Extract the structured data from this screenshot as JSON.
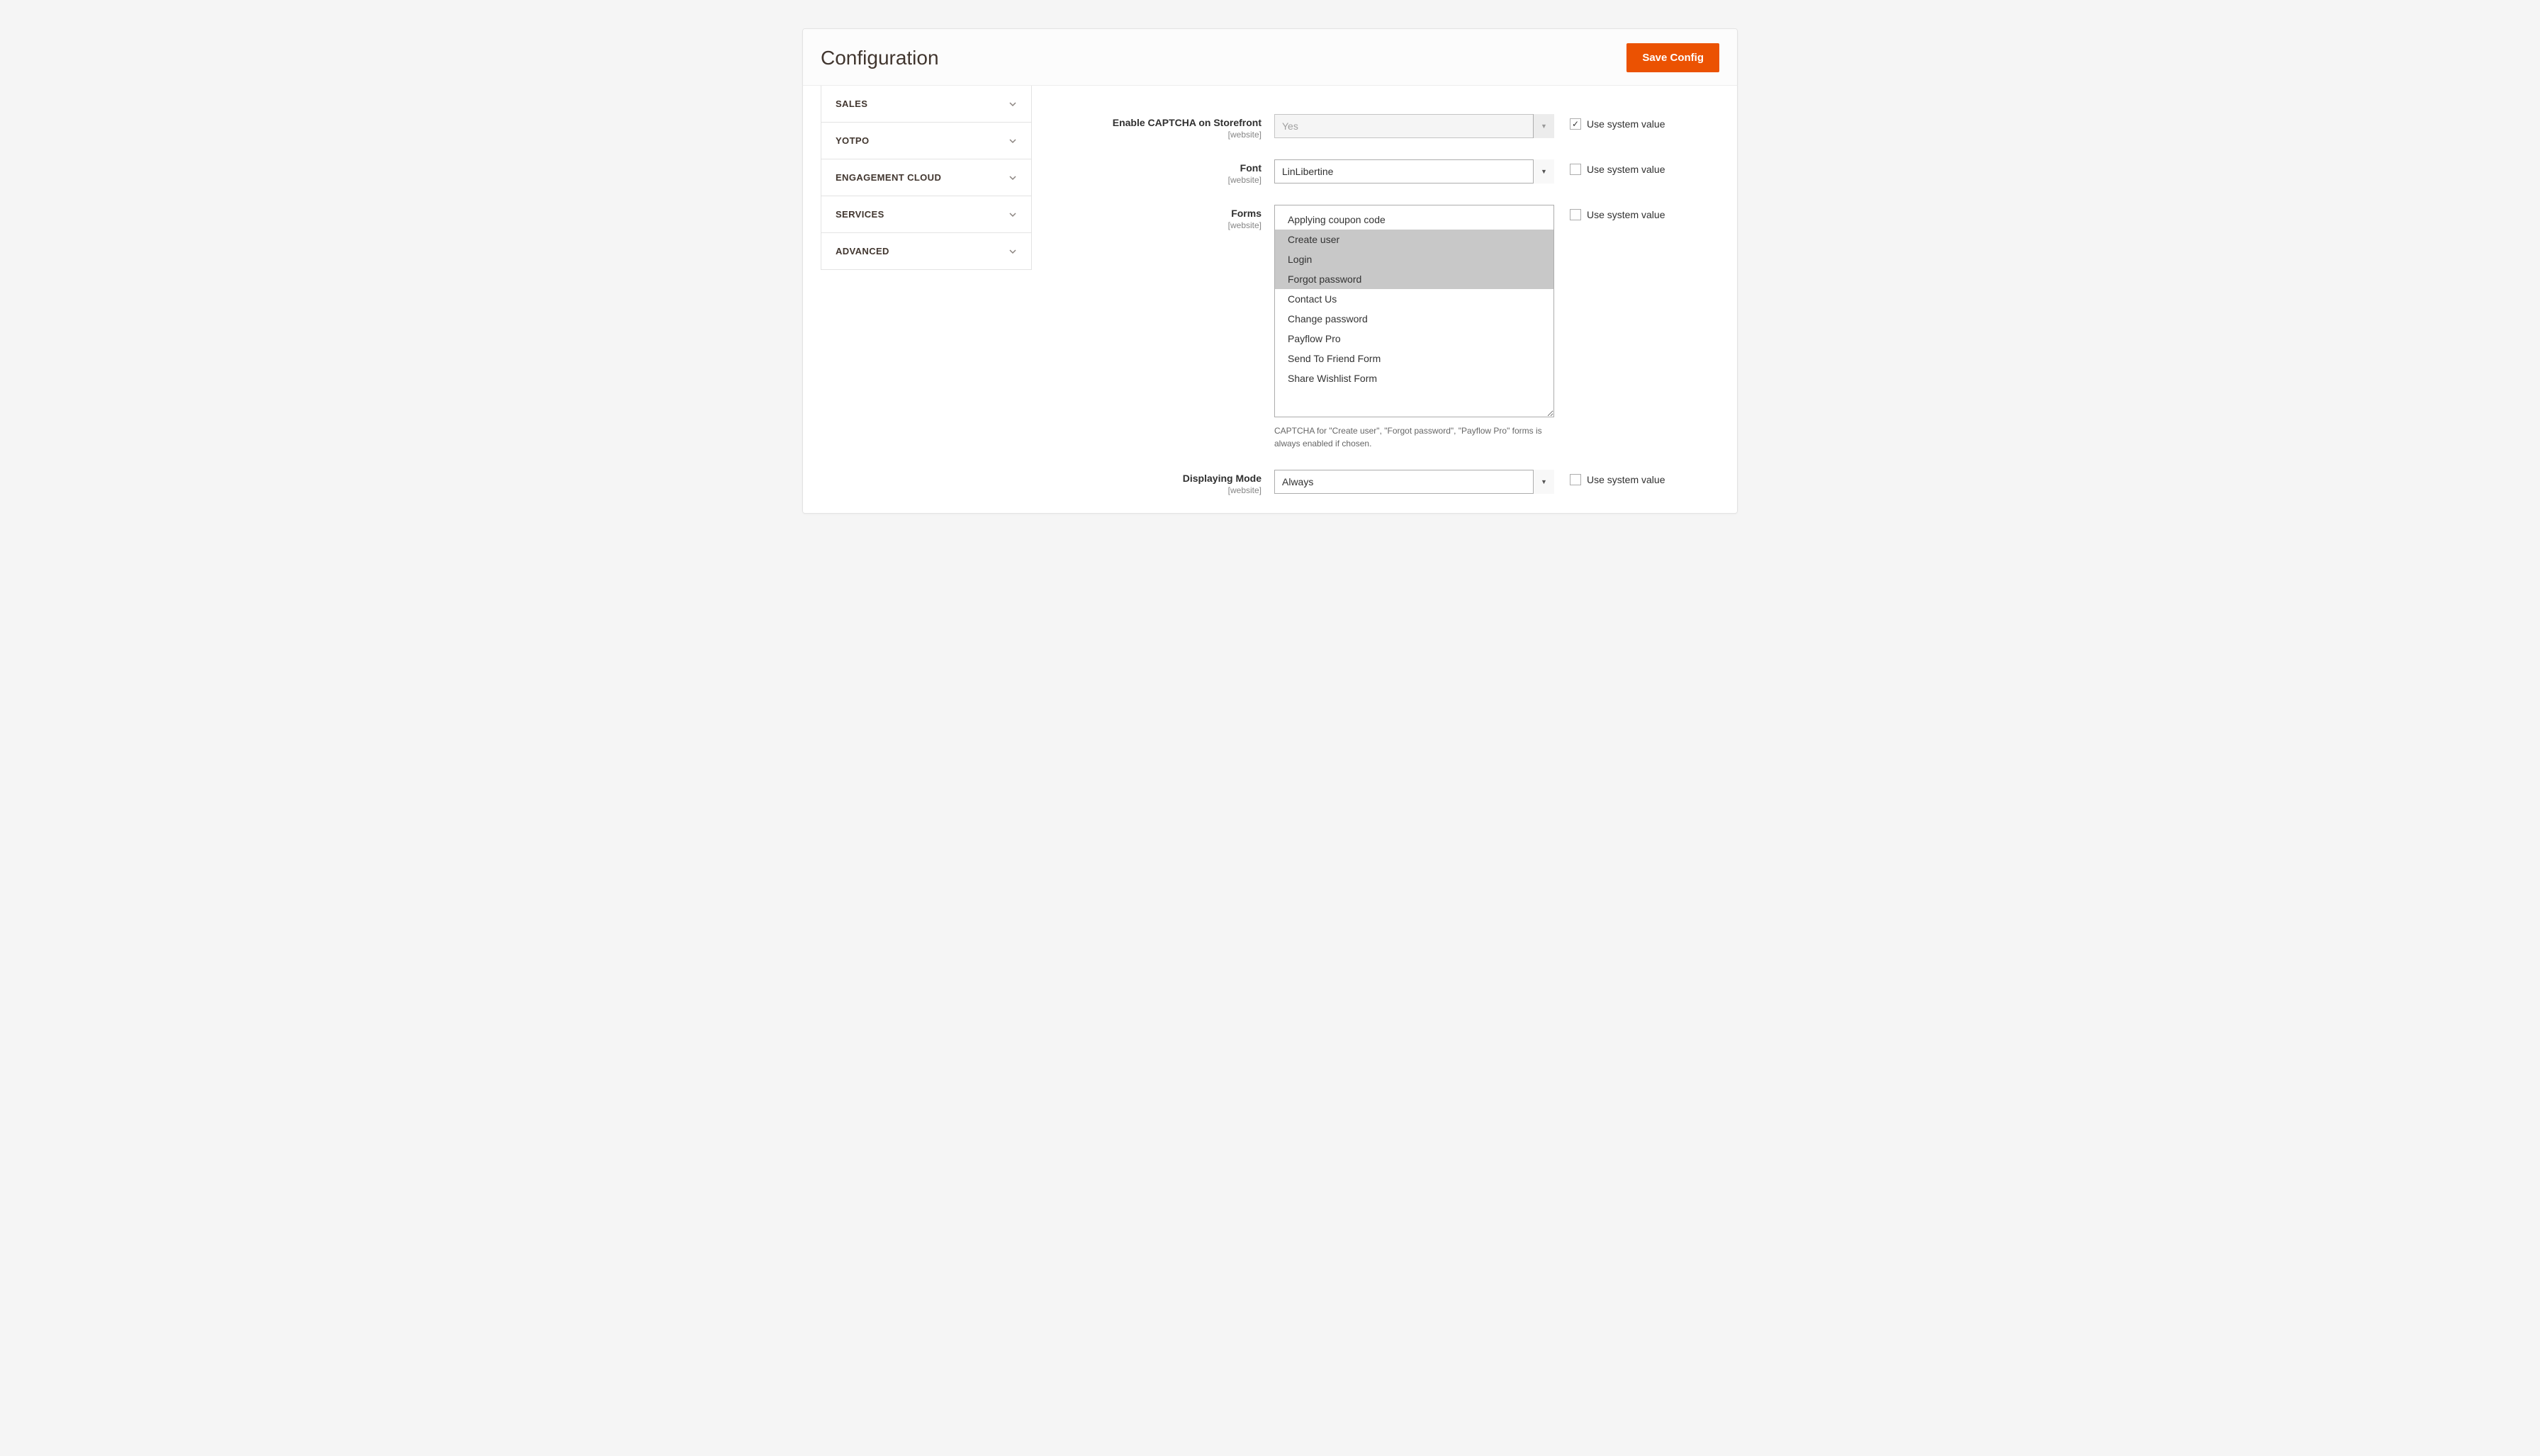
{
  "page": {
    "title": "Configuration",
    "save_button": "Save Config"
  },
  "sidebar": {
    "items": [
      {
        "label": "SALES"
      },
      {
        "label": "YOTPO"
      },
      {
        "label": "ENGAGEMENT CLOUD"
      },
      {
        "label": "SERVICES"
      },
      {
        "label": "ADVANCED"
      }
    ]
  },
  "scope_label": "[website]",
  "system_value_label": "Use system value",
  "fields": {
    "enable_captcha": {
      "label": "Enable CAPTCHA on Storefront",
      "value": "Yes",
      "use_system": true,
      "disabled": true
    },
    "font": {
      "label": "Font",
      "value": "LinLibertine",
      "use_system": false
    },
    "forms": {
      "label": "Forms",
      "options": [
        {
          "label": "Applying coupon code",
          "selected": false
        },
        {
          "label": "Create user",
          "selected": true
        },
        {
          "label": "Login",
          "selected": true
        },
        {
          "label": "Forgot password",
          "selected": true
        },
        {
          "label": "Contact Us",
          "selected": false
        },
        {
          "label": "Change password",
          "selected": false
        },
        {
          "label": "Payflow Pro",
          "selected": false
        },
        {
          "label": "Send To Friend Form",
          "selected": false
        },
        {
          "label": "Share Wishlist Form",
          "selected": false
        }
      ],
      "note": "CAPTCHA for \"Create user\", \"Forgot password\", \"Payflow Pro\" forms is always enabled if chosen.",
      "use_system": false
    },
    "displaying_mode": {
      "label": "Displaying Mode",
      "value": "Always",
      "use_system": false
    }
  }
}
